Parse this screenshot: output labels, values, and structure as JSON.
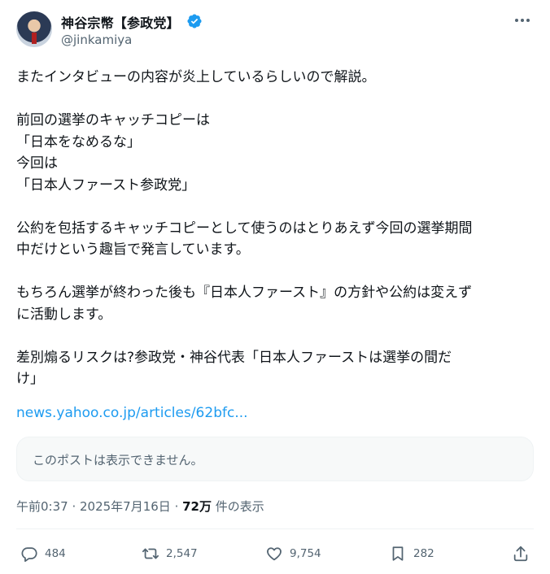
{
  "author": {
    "display_name": "神谷宗幣【参政党】",
    "handle": "@jinkamiya",
    "verified": true
  },
  "tweet": {
    "lines": [
      "またインタビューの内容が炎上しているらしいので解説。",
      "",
      "前回の選挙のキャッチコピーは",
      "「日本をなめるな」",
      "今回は",
      "「日本人ファースト参政党」",
      "",
      "公約を包括するキャッチコピーとして使うのはとりあえず今回の選挙期間",
      "中だけという趣旨で発言しています。",
      "",
      "もちろん選挙が終わった後も『日本人ファースト』の方針や公約は変えず",
      "に活動します。",
      "",
      "差別煽るリスクは?参政党・神谷代表「日本人ファーストは選挙の間だ",
      "け」"
    ],
    "link": "news.yahoo.co.jp/articles/62bfc..."
  },
  "quote_unavailable": "このポストは表示できません。",
  "meta": {
    "time": "午前0:37",
    "date": "2025年7月16日",
    "separator": " · ",
    "views": "72万",
    "views_suffix": " 件の表示"
  },
  "actions": {
    "replies": "484",
    "reposts": "2,547",
    "likes": "9,754",
    "bookmarks": "282"
  },
  "colors": {
    "accent": "#1d9bf0",
    "text": "#0f1419",
    "secondary": "#536471"
  }
}
